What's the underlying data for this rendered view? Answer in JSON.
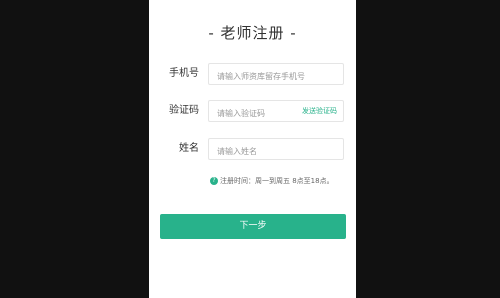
{
  "title": "- 老师注册 -",
  "fields": {
    "phone": {
      "label": "手机号",
      "placeholder": "请输入师资库留存手机号"
    },
    "code": {
      "label": "验证码",
      "placeholder": "请输入验证码",
      "send_label": "发送验证码"
    },
    "name": {
      "label": "姓名",
      "placeholder": "请输入姓名"
    }
  },
  "hint": {
    "icon": "question-icon",
    "text": "注册时间：周一到周五 8点至18点。"
  },
  "next_button": {
    "label": "下一步"
  },
  "colors": {
    "accent": "#28b28b",
    "background": "#111111",
    "panel": "#ffffff"
  }
}
